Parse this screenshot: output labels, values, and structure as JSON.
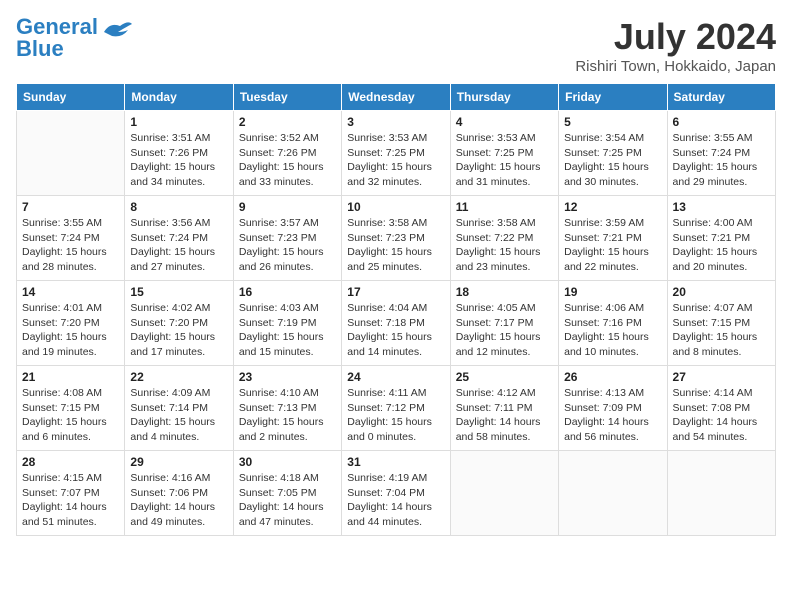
{
  "header": {
    "logo_line1": "General",
    "logo_line2": "Blue",
    "month": "July 2024",
    "location": "Rishiri Town, Hokkaido, Japan"
  },
  "days": [
    "Sunday",
    "Monday",
    "Tuesday",
    "Wednesday",
    "Thursday",
    "Friday",
    "Saturday"
  ],
  "weeks": [
    [
      {
        "date": "",
        "info": ""
      },
      {
        "date": "1",
        "info": "Sunrise: 3:51 AM\nSunset: 7:26 PM\nDaylight: 15 hours\nand 34 minutes."
      },
      {
        "date": "2",
        "info": "Sunrise: 3:52 AM\nSunset: 7:26 PM\nDaylight: 15 hours\nand 33 minutes."
      },
      {
        "date": "3",
        "info": "Sunrise: 3:53 AM\nSunset: 7:25 PM\nDaylight: 15 hours\nand 32 minutes."
      },
      {
        "date": "4",
        "info": "Sunrise: 3:53 AM\nSunset: 7:25 PM\nDaylight: 15 hours\nand 31 minutes."
      },
      {
        "date": "5",
        "info": "Sunrise: 3:54 AM\nSunset: 7:25 PM\nDaylight: 15 hours\nand 30 minutes."
      },
      {
        "date": "6",
        "info": "Sunrise: 3:55 AM\nSunset: 7:24 PM\nDaylight: 15 hours\nand 29 minutes."
      }
    ],
    [
      {
        "date": "7",
        "info": "Sunrise: 3:55 AM\nSunset: 7:24 PM\nDaylight: 15 hours\nand 28 minutes."
      },
      {
        "date": "8",
        "info": "Sunrise: 3:56 AM\nSunset: 7:24 PM\nDaylight: 15 hours\nand 27 minutes."
      },
      {
        "date": "9",
        "info": "Sunrise: 3:57 AM\nSunset: 7:23 PM\nDaylight: 15 hours\nand 26 minutes."
      },
      {
        "date": "10",
        "info": "Sunrise: 3:58 AM\nSunset: 7:23 PM\nDaylight: 15 hours\nand 25 minutes."
      },
      {
        "date": "11",
        "info": "Sunrise: 3:58 AM\nSunset: 7:22 PM\nDaylight: 15 hours\nand 23 minutes."
      },
      {
        "date": "12",
        "info": "Sunrise: 3:59 AM\nSunset: 7:21 PM\nDaylight: 15 hours\nand 22 minutes."
      },
      {
        "date": "13",
        "info": "Sunrise: 4:00 AM\nSunset: 7:21 PM\nDaylight: 15 hours\nand 20 minutes."
      }
    ],
    [
      {
        "date": "14",
        "info": "Sunrise: 4:01 AM\nSunset: 7:20 PM\nDaylight: 15 hours\nand 19 minutes."
      },
      {
        "date": "15",
        "info": "Sunrise: 4:02 AM\nSunset: 7:20 PM\nDaylight: 15 hours\nand 17 minutes."
      },
      {
        "date": "16",
        "info": "Sunrise: 4:03 AM\nSunset: 7:19 PM\nDaylight: 15 hours\nand 15 minutes."
      },
      {
        "date": "17",
        "info": "Sunrise: 4:04 AM\nSunset: 7:18 PM\nDaylight: 15 hours\nand 14 minutes."
      },
      {
        "date": "18",
        "info": "Sunrise: 4:05 AM\nSunset: 7:17 PM\nDaylight: 15 hours\nand 12 minutes."
      },
      {
        "date": "19",
        "info": "Sunrise: 4:06 AM\nSunset: 7:16 PM\nDaylight: 15 hours\nand 10 minutes."
      },
      {
        "date": "20",
        "info": "Sunrise: 4:07 AM\nSunset: 7:15 PM\nDaylight: 15 hours\nand 8 minutes."
      }
    ],
    [
      {
        "date": "21",
        "info": "Sunrise: 4:08 AM\nSunset: 7:15 PM\nDaylight: 15 hours\nand 6 minutes."
      },
      {
        "date": "22",
        "info": "Sunrise: 4:09 AM\nSunset: 7:14 PM\nDaylight: 15 hours\nand 4 minutes."
      },
      {
        "date": "23",
        "info": "Sunrise: 4:10 AM\nSunset: 7:13 PM\nDaylight: 15 hours\nand 2 minutes."
      },
      {
        "date": "24",
        "info": "Sunrise: 4:11 AM\nSunset: 7:12 PM\nDaylight: 15 hours\nand 0 minutes."
      },
      {
        "date": "25",
        "info": "Sunrise: 4:12 AM\nSunset: 7:11 PM\nDaylight: 14 hours\nand 58 minutes."
      },
      {
        "date": "26",
        "info": "Sunrise: 4:13 AM\nSunset: 7:09 PM\nDaylight: 14 hours\nand 56 minutes."
      },
      {
        "date": "27",
        "info": "Sunrise: 4:14 AM\nSunset: 7:08 PM\nDaylight: 14 hours\nand 54 minutes."
      }
    ],
    [
      {
        "date": "28",
        "info": "Sunrise: 4:15 AM\nSunset: 7:07 PM\nDaylight: 14 hours\nand 51 minutes."
      },
      {
        "date": "29",
        "info": "Sunrise: 4:16 AM\nSunset: 7:06 PM\nDaylight: 14 hours\nand 49 minutes."
      },
      {
        "date": "30",
        "info": "Sunrise: 4:18 AM\nSunset: 7:05 PM\nDaylight: 14 hours\nand 47 minutes."
      },
      {
        "date": "31",
        "info": "Sunrise: 4:19 AM\nSunset: 7:04 PM\nDaylight: 14 hours\nand 44 minutes."
      },
      {
        "date": "",
        "info": ""
      },
      {
        "date": "",
        "info": ""
      },
      {
        "date": "",
        "info": ""
      }
    ]
  ]
}
